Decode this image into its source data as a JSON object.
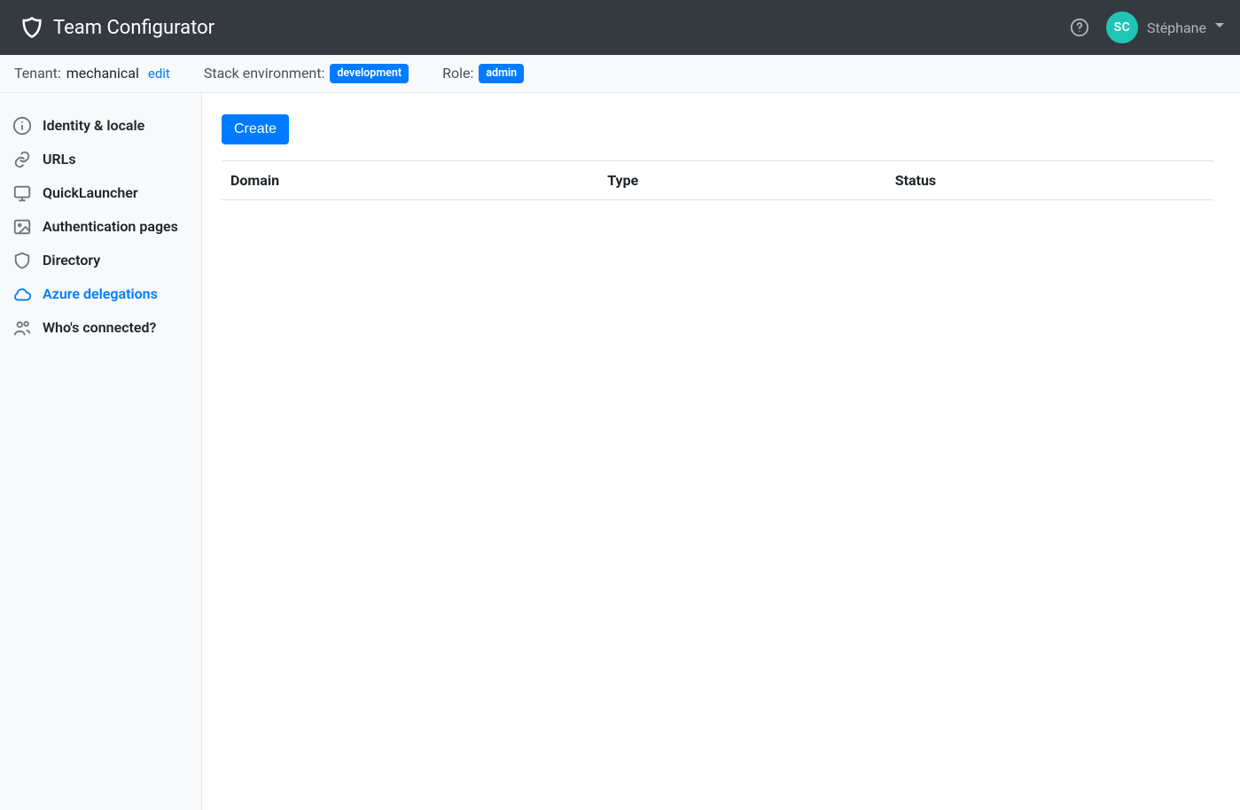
{
  "header": {
    "app_title": "Team Configurator",
    "user_initials": "SC",
    "user_name": "Stéphane"
  },
  "subheader": {
    "tenant_label": "Tenant:",
    "tenant_value": "mechanical",
    "tenant_edit": "edit",
    "stack_label": "Stack environment:",
    "stack_badge": "development",
    "role_label": "Role:",
    "role_badge": "admin"
  },
  "sidebar": {
    "items": [
      {
        "label": "Identity & locale"
      },
      {
        "label": "URLs"
      },
      {
        "label": "QuickLauncher"
      },
      {
        "label": "Authentication pages"
      },
      {
        "label": "Directory"
      },
      {
        "label": "Azure delegations"
      },
      {
        "label": "Who's connected?"
      }
    ]
  },
  "main": {
    "create_button": "Create",
    "columns": {
      "domain": "Domain",
      "type": "Type",
      "status": "Status"
    }
  }
}
